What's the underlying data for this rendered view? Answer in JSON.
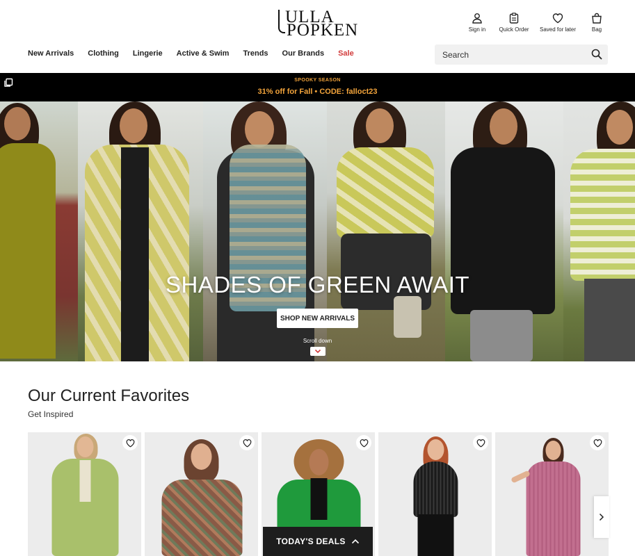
{
  "brand": {
    "logo_line1": "ULLA",
    "logo_line2": "POPKEN"
  },
  "utility": {
    "sign_in": "Sign in",
    "quick_order": "Quick Order",
    "saved": "Saved for later",
    "bag": "Bag"
  },
  "nav": {
    "items": [
      "New Arrivals",
      "Clothing",
      "Lingerie",
      "Active & Swim",
      "Trends",
      "Our Brands",
      "Sale"
    ],
    "sale_color": "#d23c3c"
  },
  "search": {
    "placeholder": "Search"
  },
  "promo": {
    "eyebrow": "SPOOKY SEASON",
    "text": "31% off for Fall • CODE: falloct23",
    "color": "#f3a43b"
  },
  "hero": {
    "title": "SHADES OF GREEN AWAIT",
    "cta": "SHOP NEW ARRIVALS",
    "scroll_label": "Scroll down"
  },
  "favorites": {
    "title": "Our Current Favorites",
    "subtitle": "Get Inspired"
  },
  "deals": {
    "label": "TODAY'S DEALS"
  },
  "icons": {
    "sign_in": "user-icon",
    "quick_order": "clipboard-icon",
    "saved": "heart-icon",
    "bag": "bag-icon",
    "search": "search-icon",
    "promo_copy": "copy-icon",
    "scroll": "chevron-down-icon",
    "carousel_next": "chevron-right-icon",
    "deals_toggle": "chevron-up-icon"
  }
}
